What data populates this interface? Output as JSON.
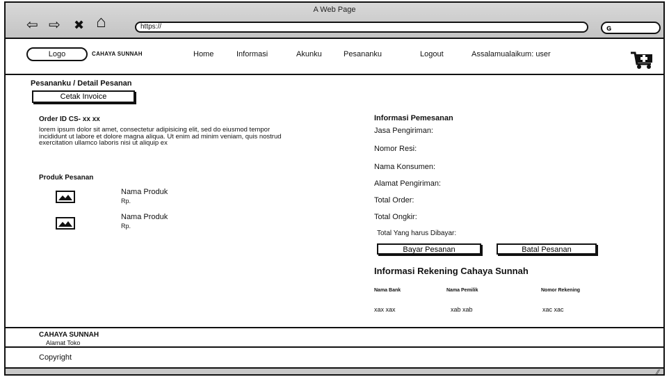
{
  "window": {
    "title": "A Web Page"
  },
  "browser": {
    "back_glyph": "⇦",
    "forward_glyph": "⇨",
    "stop_glyph": "✖",
    "home_glyph": "⌂",
    "url": "https://",
    "search_glyph": "ɢ"
  },
  "header": {
    "logo": "Logo",
    "brand": "CAHAYA SUNNAH",
    "menu": [
      "Home",
      "Informasi",
      "Akunku",
      "Pesananku",
      "Logout",
      "Assalamualaikum: user"
    ]
  },
  "content": {
    "breadcrumb": "Pesananku / Detail Pesanan",
    "print_invoice": "Cetak Invoice",
    "order_id": "Order ID CS- xx xx",
    "description": "lorem ipsum dolor sit amet, consectetur adipisicing elit, sed do eiusmod tempor incididunt ut labore et dolore magna aliqua. Ut enim ad minim veniam, quis nostrud exercitation ullamco laboris nisi ut aliquip ex",
    "products_title": "Produk Pesanan",
    "products": [
      {
        "name": "Nama Produk",
        "price": "Rp."
      },
      {
        "name": "Nama Produk",
        "price": "Rp."
      }
    ],
    "order_info": {
      "title": "Informasi Pemesanan",
      "fields": [
        "Jasa Pengiriman:",
        "Nomor Resi:",
        "Nama Konsumen:",
        "Alamat Pengiriman:",
        "Total Order:",
        "Total Ongkir:",
        "Total Yang harus Dibayar:"
      ]
    },
    "pay_button": "Bayar Pesanan",
    "cancel_button": "Batal Pesanan",
    "bank_info": {
      "title": "Informasi Rekening Cahaya Sunnah",
      "headers": [
        "Nama Bank",
        "Nama Pemilik",
        "Nomor Rekening"
      ],
      "values": [
        "xax xax",
        "xab xab",
        "xac xac"
      ]
    }
  },
  "footer": {
    "brand": "CAHAYA SUNNAH",
    "address": "Alamat Toko",
    "copyright": "Copyright"
  }
}
